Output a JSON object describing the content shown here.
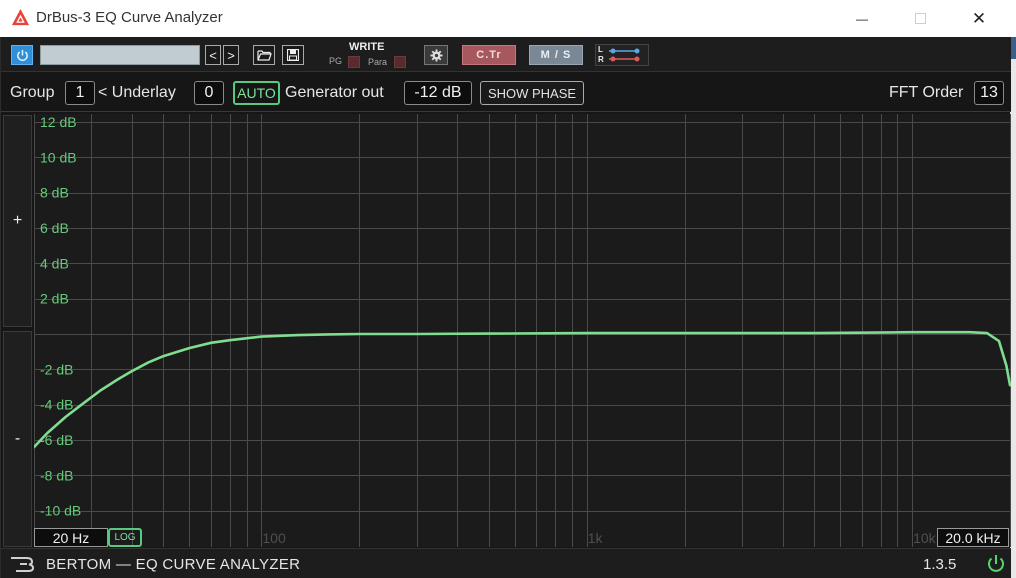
{
  "window": {
    "title": "DrBus-3 EQ Curve Analyzer",
    "minimize_glyph": "—",
    "close_glyph": "✕"
  },
  "toolbar": {
    "power_icon": "power-icon",
    "prev_glyph": "<",
    "next_glyph": ">",
    "open_icon": "folder-open-icon",
    "save_icon": "save-icon",
    "write_label": "WRITE",
    "pg_label": "PG",
    "para_label": "Para",
    "settings_icon": "gear-icon",
    "ctr_label": "C.Tr",
    "ms_label": "M / S",
    "lr_l_label": "L",
    "lr_r_label": "R"
  },
  "controls": {
    "group_label": "Group",
    "group_value": "1",
    "underlay_label": "< Underlay",
    "underlay_value": "0",
    "auto_label": "AUTO",
    "generator_label": "Generator out",
    "generator_value": "-12 dB",
    "show_phase_label": "SHOW PHASE",
    "fft_label": "FFT Order",
    "fft_value": "13"
  },
  "gain": {
    "plus_label": "+",
    "minus_label": "-"
  },
  "freq_range": {
    "low": "20 Hz",
    "high": "20.0 kHz",
    "log_label": "LOG"
  },
  "footer": {
    "brand": "BERTOM — EQ CURVE ANALYZER",
    "version": "1.3.5"
  },
  "colors": {
    "curve": "#7fdd8f",
    "db_label": "#67c97a",
    "grid": "#4a4a4a",
    "power_green": "#52d66a"
  },
  "chart_data": {
    "type": "line",
    "x_scale": "log",
    "xlim": [
      20,
      20000
    ],
    "ylim": [
      -12,
      12
    ],
    "grid": true,
    "y_tick_labels": [
      {
        "value": 12,
        "label": "12 dB"
      },
      {
        "value": 10,
        "label": "10 dB"
      },
      {
        "value": 8,
        "label": "8 dB"
      },
      {
        "value": 6,
        "label": "6 dB"
      },
      {
        "value": 4,
        "label": "4 dB"
      },
      {
        "value": 2,
        "label": "2 dB"
      },
      {
        "value": -2,
        "label": "-2 dB"
      },
      {
        "value": -4,
        "label": "-4 dB"
      },
      {
        "value": -6,
        "label": "-6 dB"
      },
      {
        "value": -8,
        "label": "-8 dB"
      },
      {
        "value": -10,
        "label": "-10 dB"
      }
    ],
    "x_tick_labels": [
      {
        "value": 100,
        "label": "100"
      },
      {
        "value": 1000,
        "label": "1k"
      },
      {
        "value": 10000,
        "label": "10k"
      }
    ],
    "series": [
      {
        "x": [
          20,
          22,
          25,
          28,
          32,
          36,
          40,
          45,
          50,
          60,
          70,
          80,
          100,
          130,
          160,
          200,
          300,
          500,
          1000,
          2000,
          5000,
          10000,
          15000,
          17000,
          18500,
          19500,
          20000
        ],
        "y": [
          -6.4,
          -5.6,
          -4.7,
          -4.0,
          -3.2,
          -2.6,
          -2.1,
          -1.6,
          -1.25,
          -0.8,
          -0.5,
          -0.35,
          -0.15,
          -0.06,
          -0.02,
          0.0,
          0.0,
          0.02,
          0.05,
          0.05,
          0.05,
          0.1,
          0.1,
          0.05,
          -0.4,
          -1.8,
          -2.9
        ]
      }
    ]
  }
}
